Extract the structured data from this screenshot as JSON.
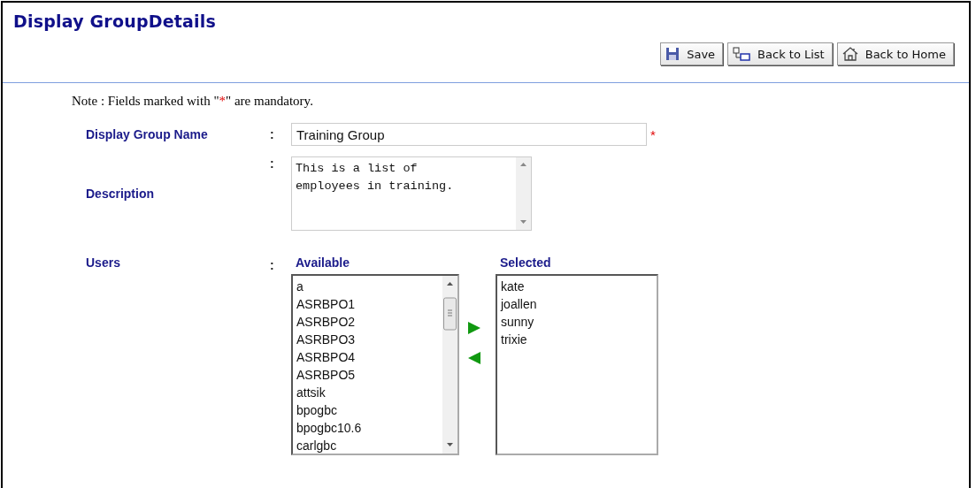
{
  "page": {
    "title": "Display GroupDetails"
  },
  "toolbar": [
    {
      "kind": "save",
      "label": "Save"
    },
    {
      "kind": "list",
      "label": "Back to List"
    },
    {
      "kind": "home",
      "label": "Back to Home"
    }
  ],
  "note": {
    "before": "Note : Fields marked with \"",
    "mark": "*",
    "after": "\" are mandatory."
  },
  "fields": [
    {
      "kind": "text",
      "label": "Display Group Name",
      "colon": ":",
      "value": "Training Group",
      "required_mark": "*"
    },
    {
      "kind": "textarea",
      "label": "Description",
      "colon": ":",
      "value": "This is a list of\nemployees in training."
    }
  ],
  "users": {
    "label": "Users",
    "colon": ":",
    "available": {
      "heading": "Available",
      "items": [
        "a",
        "ASRBPO1",
        "ASRBPO2",
        "ASRBPO3",
        "ASRBPO4",
        "ASRBPO5",
        "attsik",
        "bpogbc",
        "bpogbc10.6",
        "carlgbc"
      ]
    },
    "selected": {
      "heading": "Selected",
      "items": [
        "kate",
        "joallen",
        "sunny",
        "trixie"
      ]
    }
  }
}
